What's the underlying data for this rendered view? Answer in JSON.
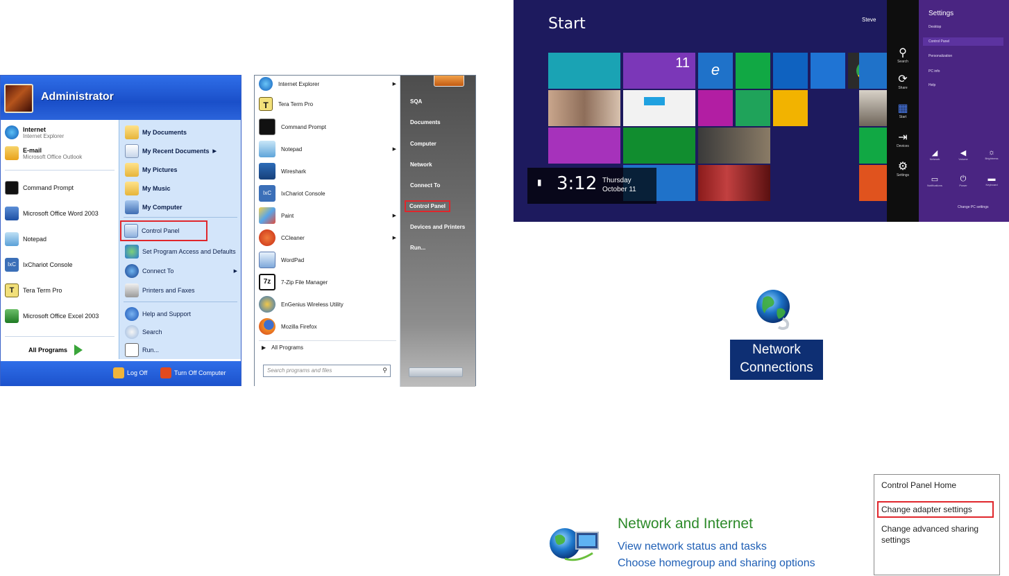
{
  "xp_menu": {
    "username": "Administrator",
    "pinned": [
      {
        "title": "Internet",
        "subtitle": "Internet Explorer"
      },
      {
        "title": "E-mail",
        "subtitle": "Microsoft Office Outlook"
      }
    ],
    "recent": [
      "Command Prompt",
      "Microsoft Office Word 2003",
      "Notepad",
      "IxChariot Console",
      "Tera Term Pro",
      "Microsoft Office Excel 2003"
    ],
    "all_programs": "All Programs",
    "right": [
      "My Documents",
      "My Recent Documents",
      "My Pictures",
      "My Music",
      "My Computer",
      "Control Panel",
      "Set Program Access and Defaults",
      "Connect To",
      "Printers and Faxes",
      "Help and Support",
      "Search",
      "Run..."
    ],
    "log_off": "Log Off",
    "turn_off": "Turn Off Computer"
  },
  "win7_menu": {
    "programs": [
      "Internet Explorer",
      "Tera Term Pro",
      "Command Prompt",
      "Notepad",
      "Wireshark",
      "IxChariot Console",
      "Paint",
      "CCleaner",
      "WordPad",
      "7-Zip File Manager",
      "EnGenius Wireless Utility",
      "Mozilla Firefox"
    ],
    "all_programs": "All Programs",
    "search_placeholder": "Search programs and files",
    "right": [
      "SQA",
      "Documents",
      "Computer",
      "Network",
      "Connect To",
      "Control Panel",
      "Devices and Printers",
      "Run..."
    ]
  },
  "win8": {
    "start": "Start",
    "user": "Steve",
    "time": "3:12",
    "day": "Thursday",
    "date": "October 11",
    "calendar_day": "11",
    "charms": [
      "Search",
      "Share",
      "Start",
      "Devices",
      "Settings"
    ],
    "settings": {
      "title": "Settings",
      "items": [
        "Desktop",
        "Control Panel",
        "Personalization",
        "PC info",
        "Help"
      ],
      "change_pc": "Change PC settings",
      "sys_icons": [
        "Network",
        "Volume",
        "Brightness",
        "Notifications",
        "Power",
        "Keyboard"
      ]
    },
    "colors": {
      "background": "#1d1a5e",
      "settings_pane": "#4a2582"
    }
  },
  "network_connections": {
    "line1": "Network",
    "line2": "Connections"
  },
  "network_internet": {
    "title": "Network and Internet",
    "links": [
      "View network status and tasks",
      "Choose homegroup and sharing options"
    ]
  },
  "cp_sidebar": {
    "items": [
      "Control Panel Home",
      "Change adapter settings",
      "Change advanced sharing settings"
    ]
  },
  "highlight_color": "#e0262b"
}
